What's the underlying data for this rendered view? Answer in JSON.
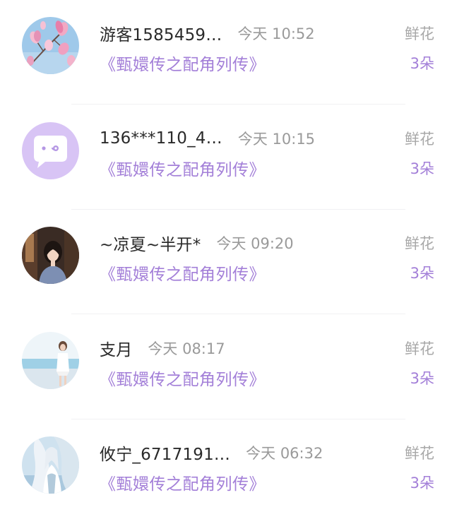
{
  "colors": {
    "accent_purple": "#a37fd8",
    "name_text": "#2a2a2a",
    "muted_text": "#9a9a9a"
  },
  "items": [
    {
      "username": "游客1585459…",
      "time": "今天 10:52",
      "book": "《甄嬛传之配角列传》",
      "gift_label": "鲜花",
      "gift_count": "3朵",
      "avatar_icon": "magnolia-flower-avatar"
    },
    {
      "username": "136***110_4…",
      "time": "今天 10:15",
      "book": "《甄嬛传之配角列传》",
      "gift_label": "鲜花",
      "gift_count": "3朵",
      "avatar_icon": "chat-bubble-avatar"
    },
    {
      "username": "~凉夏~半开*",
      "time": "今天 09:20",
      "book": "《甄嬛传之配角列传》",
      "gift_label": "鲜花",
      "gift_count": "3朵",
      "avatar_icon": "girl-portrait-avatar"
    },
    {
      "username": "支月",
      "time": "今天 08:17",
      "book": "《甄嬛传之配角列传》",
      "gift_label": "鲜花",
      "gift_count": "3朵",
      "avatar_icon": "beach-figure-avatar"
    },
    {
      "username": "攸宁_6717191…",
      "time": "今天 06:32",
      "book": "《甄嬛传之配角列传》",
      "gift_label": "鲜花",
      "gift_count": "3朵",
      "avatar_icon": "ancient-figure-avatar"
    }
  ]
}
